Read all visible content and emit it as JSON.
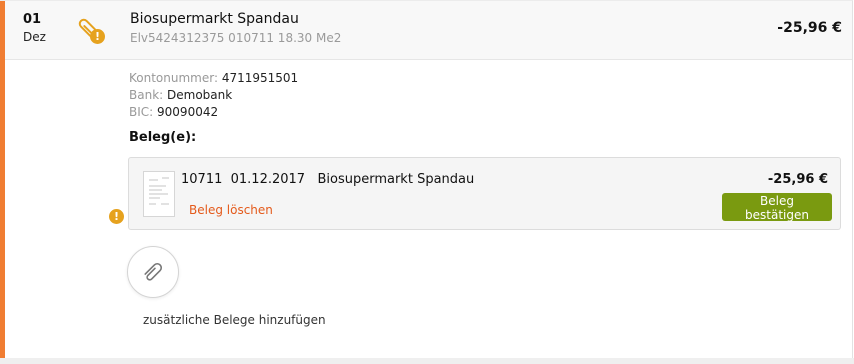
{
  "transaction": {
    "day": "01",
    "month": "Dez",
    "merchant": "Biosupermarkt Spandau",
    "reference": "Elv5424312375 010711 18.30 Me2",
    "amount": "-25,96 €"
  },
  "account": {
    "kontonummer_label": "Kontonummer:",
    "kontonummer": "4711951501",
    "bank_label": "Bank:",
    "bank": "Demobank",
    "bic_label": "BIC:",
    "bic": "90090042"
  },
  "beleg": {
    "title": "Beleg(e):",
    "items": [
      {
        "number": "10711",
        "date": "01.12.2017",
        "merchant": "Biosupermarkt Spandau",
        "amount": "-25,96 €",
        "delete_label": "Beleg löschen",
        "confirm_label": "Beleg bestätigen"
      }
    ]
  },
  "add": {
    "label": "zusätzliche Belege hinzufügen"
  },
  "icons": {
    "attachment": "paperclip-icon",
    "warning": "exclamation-icon",
    "receipt_thumbnail": "document-thumbnail-icon"
  },
  "colors": {
    "accent": "#f07d32",
    "warning": "#e6a21e",
    "delete_link": "#e45a1b",
    "confirm_button": "#7a9a10"
  }
}
